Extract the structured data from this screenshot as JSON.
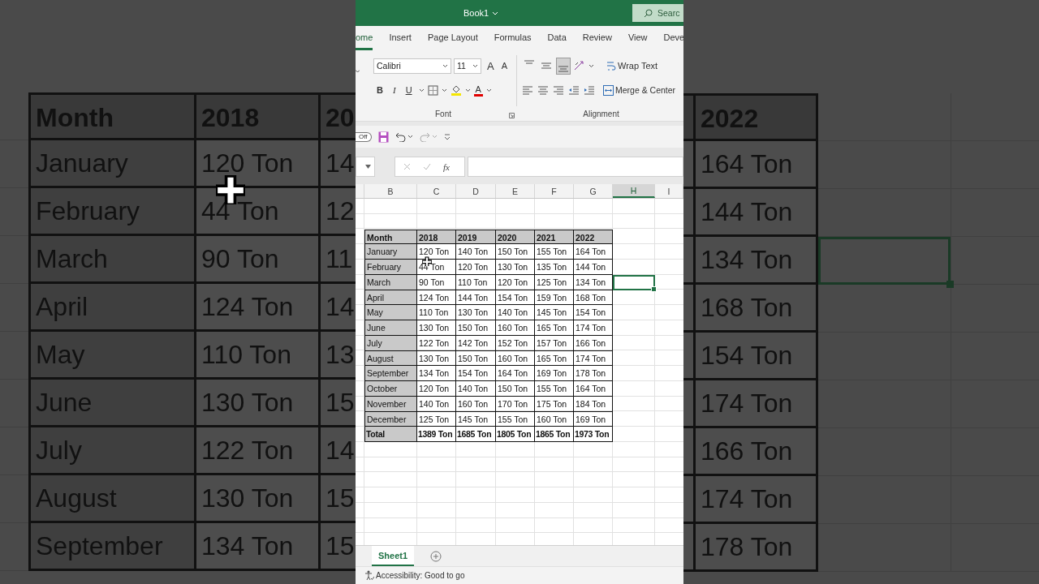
{
  "backdrop_left": {
    "rows": [
      {
        "kind": "header",
        "cells": [
          "Month",
          "2018",
          "20"
        ]
      },
      {
        "kind": "data",
        "cells": [
          "January",
          "120 Ton",
          "14"
        ]
      },
      {
        "kind": "data",
        "cells": [
          "February",
          "44 Ton",
          "12"
        ]
      },
      {
        "kind": "data",
        "cells": [
          "March",
          "90 Ton",
          "11"
        ]
      },
      {
        "kind": "data",
        "cells": [
          "April",
          "124 Ton",
          "14"
        ]
      },
      {
        "kind": "data",
        "cells": [
          "May",
          "110 Ton",
          "13"
        ]
      },
      {
        "kind": "data",
        "cells": [
          "June",
          "130 Ton",
          "15"
        ]
      },
      {
        "kind": "data",
        "cells": [
          "July",
          "122 Ton",
          "14"
        ]
      },
      {
        "kind": "data",
        "cells": [
          "August",
          "130 Ton",
          "15"
        ]
      },
      {
        "kind": "data",
        "cells": [
          "September",
          "134 Ton",
          "15"
        ]
      }
    ]
  },
  "title_bar": {
    "title": "Book1",
    "search_placeholder": "Searc"
  },
  "ribbon_tabs": [
    {
      "label": "ome",
      "selected": true
    },
    {
      "label": "Insert",
      "selected": false
    },
    {
      "label": "Page Layout",
      "selected": false
    },
    {
      "label": "Formulas",
      "selected": false
    },
    {
      "label": "Data",
      "selected": false
    },
    {
      "label": "Review",
      "selected": false
    },
    {
      "label": "View",
      "selected": false
    },
    {
      "label": "Deve",
      "selected": false
    }
  ],
  "ribbon": {
    "font_name": "Calibri",
    "font_size": "11",
    "grow_font": "A",
    "shrink_font": "A",
    "format_buttons": [
      {
        "kind": "bold",
        "label": "B"
      },
      {
        "kind": "italic",
        "label": "I"
      },
      {
        "kind": "underline",
        "label": "U"
      }
    ],
    "font_color": "A",
    "font_group": "Font",
    "align_buttons": [
      {
        "kind": "top",
        "selected": false
      },
      {
        "kind": "middle",
        "selected": false
      },
      {
        "kind": "bottom",
        "selected": true
      }
    ],
    "wrap_text": "Wrap Text",
    "merge_center": "Merge & Center",
    "alignment_group": "Alignment"
  },
  "quick_access": {
    "autosave": "Off"
  },
  "formula_bar": {
    "function_label": "fx"
  },
  "column_headers": [
    {
      "label": "B",
      "selected": false
    },
    {
      "label": "C",
      "selected": false
    },
    {
      "label": "D",
      "selected": false
    },
    {
      "label": "E",
      "selected": false
    },
    {
      "label": "F",
      "selected": false
    },
    {
      "label": "G",
      "selected": false
    },
    {
      "label": "H",
      "selected": true
    },
    {
      "label": "I",
      "selected": false
    }
  ],
  "table": {
    "rows": [
      {
        "kind": "header",
        "cells": [
          "Month",
          "2018",
          "2019",
          "2020",
          "2021",
          "2022"
        ],
        "h_selected": false
      },
      {
        "kind": "data",
        "cells": [
          "January",
          "120 Ton",
          "140 Ton",
          "150 Ton",
          "155 Ton",
          "164 Ton"
        ],
        "h_selected": false
      },
      {
        "kind": "data",
        "cells": [
          "February",
          "44 Ton",
          "120 Ton",
          "130 Ton",
          "135 Ton",
          "144 Ton"
        ],
        "h_selected": false
      },
      {
        "kind": "data",
        "cells": [
          "March",
          "90 Ton",
          "110 Ton",
          "120 Ton",
          "125 Ton",
          "134 Ton"
        ],
        "h_selected": true
      },
      {
        "kind": "data",
        "cells": [
          "April",
          "124 Ton",
          "144 Ton",
          "154 Ton",
          "159 Ton",
          "168 Ton"
        ],
        "h_selected": false
      },
      {
        "kind": "data",
        "cells": [
          "May",
          "110 Ton",
          "130 Ton",
          "140 Ton",
          "145 Ton",
          "154 Ton"
        ],
        "h_selected": false
      },
      {
        "kind": "data",
        "cells": [
          "June",
          "130 Ton",
          "150 Ton",
          "160 Ton",
          "165 Ton",
          "174 Ton"
        ],
        "h_selected": false
      },
      {
        "kind": "data",
        "cells": [
          "July",
          "122 Ton",
          "142 Ton",
          "152 Ton",
          "157 Ton",
          "166 Ton"
        ],
        "h_selected": false
      },
      {
        "kind": "data",
        "cells": [
          "August",
          "130 Ton",
          "150 Ton",
          "160 Ton",
          "165 Ton",
          "174 Ton"
        ],
        "h_selected": false
      },
      {
        "kind": "data",
        "cells": [
          "September",
          "134 Ton",
          "154 Ton",
          "164 Ton",
          "169 Ton",
          "178 Ton"
        ],
        "h_selected": false
      },
      {
        "kind": "data",
        "cells": [
          "October",
          "120 Ton",
          "140 Ton",
          "150 Ton",
          "155 Ton",
          "164 Ton"
        ],
        "h_selected": false
      },
      {
        "kind": "data",
        "cells": [
          "November",
          "140 Ton",
          "160 Ton",
          "170 Ton",
          "175 Ton",
          "184 Ton"
        ],
        "h_selected": false
      },
      {
        "kind": "data",
        "cells": [
          "December",
          "125 Ton",
          "145 Ton",
          "155 Ton",
          "160 Ton",
          "169 Ton"
        ],
        "h_selected": false
      },
      {
        "kind": "total",
        "cells": [
          "Total",
          "1389 Ton",
          "1685 Ton",
          "1805 Ton",
          "1865 Ton",
          "1973 Ton"
        ],
        "h_selected": false
      }
    ]
  },
  "sheet_tabs": [
    {
      "label": "Sheet1",
      "selected": true
    }
  ],
  "status_bar": {
    "accessibility": "Accessibility: Good to go"
  },
  "backdrop_right": {
    "rows": [
      {
        "kind": "header",
        "cells": [
          "2022"
        ],
        "next_selected": false
      },
      {
        "kind": "data",
        "cells": [
          "164 Ton"
        ],
        "next_selected": false
      },
      {
        "kind": "data",
        "cells": [
          "144 Ton"
        ],
        "next_selected": false
      },
      {
        "kind": "data",
        "cells": [
          "134 Ton"
        ],
        "next_selected": true
      },
      {
        "kind": "data",
        "cells": [
          "168 Ton"
        ],
        "next_selected": false
      },
      {
        "kind": "data",
        "cells": [
          "154 Ton"
        ],
        "next_selected": false
      },
      {
        "kind": "data",
        "cells": [
          "174 Ton"
        ],
        "next_selected": false
      },
      {
        "kind": "data",
        "cells": [
          "166 Ton"
        ],
        "next_selected": false
      },
      {
        "kind": "data",
        "cells": [
          "174 Ton"
        ],
        "next_selected": false
      },
      {
        "kind": "data",
        "cells": [
          "178 Ton"
        ],
        "next_selected": false
      }
    ]
  }
}
